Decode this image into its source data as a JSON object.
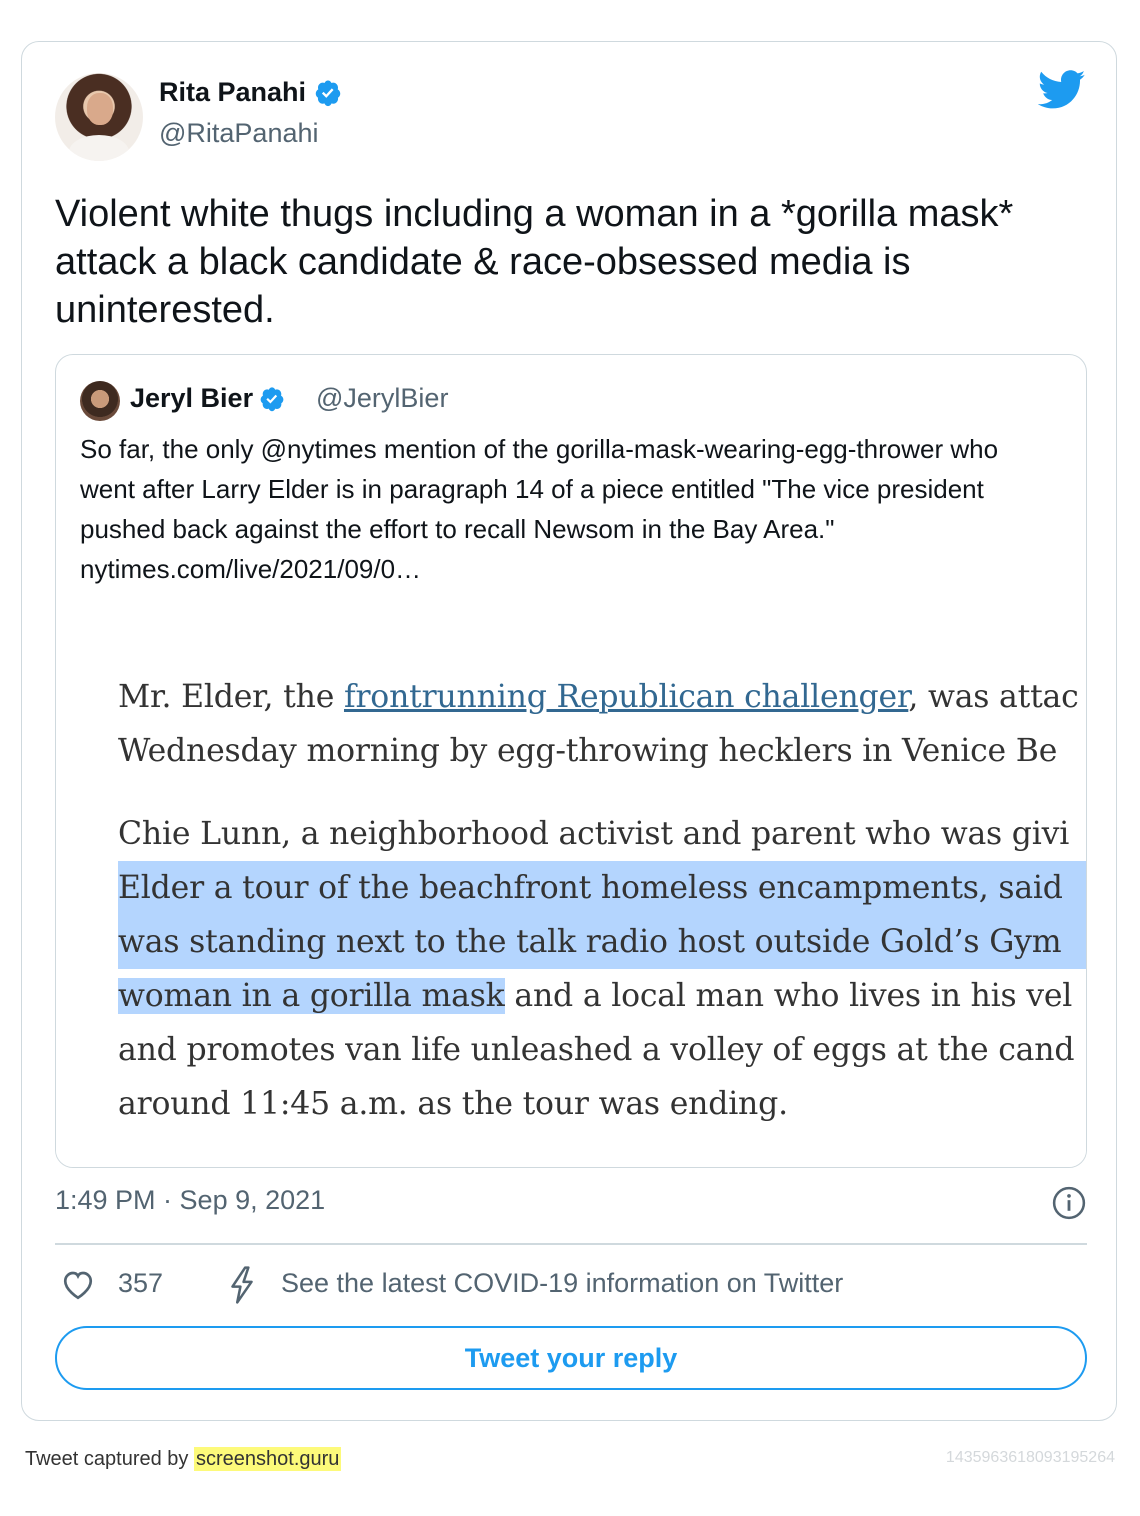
{
  "tweet": {
    "author_name": "Rita Panahi",
    "author_handle": "@RitaPanahi",
    "text": "Violent white thugs including a woman in a *gorilla mask* attack a black candidate & race-obsessed media is uninterested.",
    "timestamp": "1:49 PM · Sep 9, 2021",
    "likes": "357",
    "covid_notice": "See the latest COVID-19 information on Twitter",
    "reply_button": "Tweet your reply"
  },
  "quoted": {
    "author_name": "Jeryl Bier",
    "author_handle": "@JerylBier",
    "text": "So far, the only @nytimes mention of the gorilla-mask-wearing-egg-thrower who went after Larry Elder is in paragraph 14 of a piece entitled \"The vice president pushed back against the effort to recall Newsom in the Bay Area.\"",
    "link": "nytimes.com/live/2021/09/0…",
    "image_lines": {
      "l1a": "Mr. Elder, the ",
      "l1link": "frontrunning Republican challenger",
      "l1b": ", was attac",
      "l2": "Wednesday morning by egg-throwing hecklers in Venice Be",
      "l3": "Chie Lunn, a neighborhood activist and parent who was givi",
      "l4": "Elder a tour of the beachfront homeless encampments, said",
      "l5": "was standing next to the talk radio host outside Gold’s Gym",
      "l6hl": "woman in a gorilla mask",
      "l6b": " and a local man who lives in his vel",
      "l7": "and promotes van life unleashed a volley of eggs at the cand",
      "l8": "around 11:45 a.m. as the tour was ending."
    }
  },
  "footer": {
    "captured_by": "Tweet captured by ",
    "brand": "screenshot.guru",
    "tweet_id": "1435963618093195264"
  },
  "colors": {
    "accent": "#1d9bf0",
    "highlight": "#b4d5fe",
    "muted": "#536471"
  },
  "icons": [
    "twitter-bird-icon",
    "verified-badge-icon",
    "info-icon",
    "heart-icon",
    "lightning-bolt-icon"
  ]
}
